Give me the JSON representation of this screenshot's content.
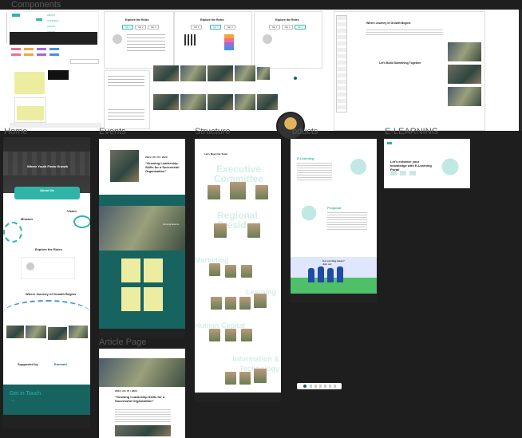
{
  "canvas": {
    "background": "#1e1e1e",
    "accent_teal": "#17635f",
    "accent_mint": "#2fb5a8",
    "placeholder_yellow": "#eceda0"
  },
  "frames": {
    "components": "Components",
    "home": "Home",
    "events": "Events",
    "structure": "Structure",
    "products": "oducts",
    "elearning": "E-LEARNING",
    "article": "Article Page"
  },
  "components": {
    "nav_links": [
      "ABOUT",
      "CONNECT",
      "LEARN",
      "GROW"
    ],
    "tabs_title": "Explore the Roles",
    "tabs": [
      "Tab 1",
      "Tab 2",
      "Tab 3"
    ],
    "journey_title": "Where Journey of Growth Begins",
    "build_together": "Let's Build Something Together"
  },
  "home": {
    "hero_title": "Where Youth Finds Growth",
    "about_label": "About Us",
    "mission_label": "Mission",
    "vision_label": "Vision",
    "roles_title": "Explore the Roles",
    "journey_title": "Where Journey of Growth Begins",
    "supported_by": "Supported by",
    "sponsor": "Emerald",
    "get_in_touch": "Get in Touch →"
  },
  "events": {
    "date": "2024 / 20 / 07 / 2023",
    "title": "“Growing Leadership Skills for a Successful Organization”",
    "gallery_title": "Coming Events"
  },
  "structure": {
    "team_title": "Let's Meet Our Team",
    "executive": "Executive Committee",
    "regional": "Regional President",
    "marketing": "Marketing",
    "learning": "Learning",
    "human_capital": "Human Capital",
    "it": "Information & Technology"
  },
  "products": {
    "elearning": "E-Learning",
    "proposal": "Proposal",
    "banner": "Got exciting ideas? Join us!"
  },
  "elearning": {
    "headline": "Let's enhance your knowledge with E-Learning Portal"
  },
  "article": {
    "date": "2024 / 20 / 07 / 2023",
    "title": "“Growing Leadership Skills for a Successful Organization”"
  },
  "avatar_initials": "A"
}
